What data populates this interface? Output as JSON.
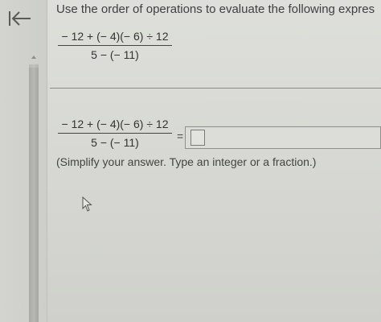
{
  "header": {
    "instruction": "Use the order of operations to evaluate the following expres"
  },
  "problem": {
    "numerator": "− 12 + (− 4)(− 6) ÷ 12",
    "denominator": "5 − (− 11)"
  },
  "answer": {
    "numerator": "− 12 + (− 4)(− 6) ÷ 12",
    "denominator": "5 − (− 11)",
    "equals": "=",
    "value": "",
    "hint": "(Simplify your answer. Type an integer or a fraction.)"
  },
  "icons": {
    "back": "back-arrow-icon",
    "scroll_up": "chevron-up-icon",
    "pointer": "mouse-pointer-icon"
  },
  "colors": {
    "text": "#444444",
    "divider": "#8a8b86",
    "input_border": "#8f908b"
  }
}
